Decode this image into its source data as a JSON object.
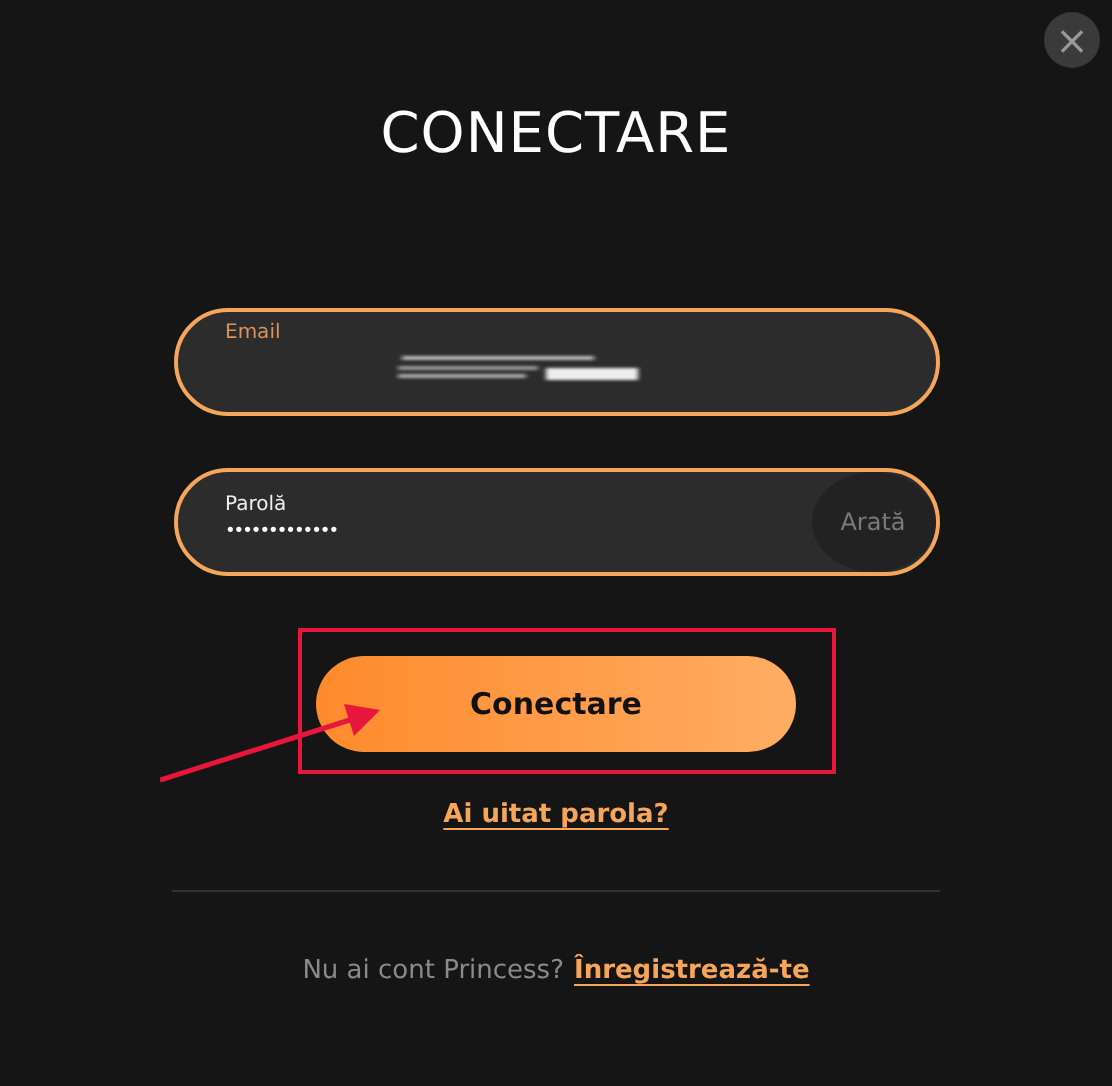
{
  "dialog": {
    "title": "CONECTARE",
    "close_button": "×"
  },
  "email_field": {
    "label": "Email",
    "redacted": true
  },
  "password_field": {
    "label": "Parolă",
    "value": "•••••••••••••",
    "show_button": "Arată"
  },
  "submit_button": {
    "label": "Conectare",
    "highlighted": true
  },
  "forgot_link": "Ai uitat parola?",
  "footer": {
    "text": "Nu ai cont Princess?",
    "link": "Înregistrează-te"
  }
}
